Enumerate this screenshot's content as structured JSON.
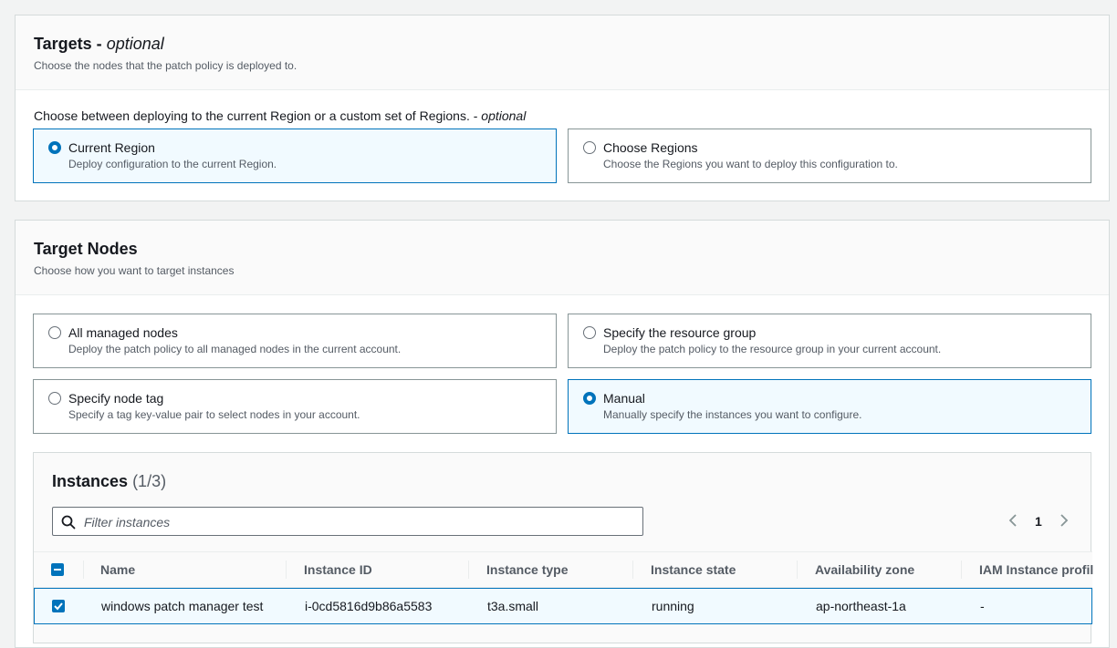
{
  "targets": {
    "title": "Targets - ",
    "title_optional": "optional",
    "description": "Choose the nodes that the patch policy is deployed to.",
    "region_label": "Choose between deploying to the current Region or a custom set of Regions. - ",
    "region_label_optional": "optional",
    "options": [
      {
        "title": "Current Region",
        "desc": "Deploy configuration to the current Region.",
        "selected": true
      },
      {
        "title": "Choose Regions",
        "desc": "Choose the Regions you want to deploy this configuration to.",
        "selected": false
      }
    ]
  },
  "target_nodes": {
    "title": "Target Nodes",
    "description": "Choose how you want to target instances",
    "options": [
      {
        "title": "All managed nodes",
        "desc": "Deploy the patch policy to all managed nodes in the current account.",
        "selected": false
      },
      {
        "title": "Specify the resource group",
        "desc": "Deploy the patch policy to the resource group in your current account.",
        "selected": false
      },
      {
        "title": "Specify node tag",
        "desc": "Specify a tag key-value pair to select nodes in your account.",
        "selected": false
      },
      {
        "title": "Manual",
        "desc": "Manually specify the instances you want to configure.",
        "selected": true
      }
    ]
  },
  "instances": {
    "title": "Instances",
    "count": "(1/3)",
    "filter_placeholder": "Filter instances",
    "page": "1",
    "columns": [
      "Name",
      "Instance ID",
      "Instance type",
      "Instance state",
      "Availability zone",
      "IAM Instance profil"
    ],
    "rows": [
      {
        "name": "windows patch manager test",
        "id": "i-0cd5816d9b86a5583",
        "type": "t3a.small",
        "state": "running",
        "az": "ap-northeast-1a",
        "iam": "-",
        "checked": true
      }
    ]
  },
  "colors": {
    "accent": "#0073bb",
    "selected_bg": "#f1faff",
    "border": "#879596"
  },
  "icons": [
    "search-icon",
    "chevron-left-icon",
    "chevron-right-icon",
    "checkbox-indeterminate-icon",
    "checkbox-checked-icon"
  ]
}
